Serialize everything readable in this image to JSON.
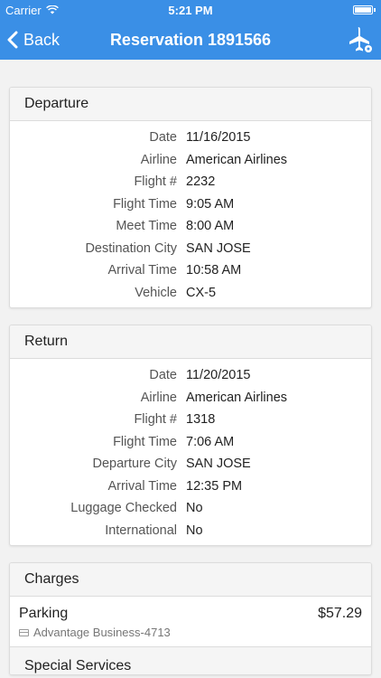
{
  "status_bar": {
    "carrier": "Carrier",
    "time": "5:21 PM"
  },
  "nav": {
    "back_label": "Back",
    "title": "Reservation 1891566"
  },
  "departure": {
    "title": "Departure",
    "rows": [
      {
        "label": "Date",
        "value": "11/16/2015"
      },
      {
        "label": "Airline",
        "value": "American Airlines"
      },
      {
        "label": "Flight #",
        "value": "2232"
      },
      {
        "label": "Flight Time",
        "value": "9:05 AM"
      },
      {
        "label": "Meet Time",
        "value": "8:00 AM"
      },
      {
        "label": "Destination City",
        "value": "SAN JOSE"
      },
      {
        "label": "Arrival Time",
        "value": "10:58 AM"
      },
      {
        "label": "Vehicle",
        "value": "CX-5"
      }
    ]
  },
  "return": {
    "title": "Return",
    "rows": [
      {
        "label": "Date",
        "value": "11/20/2015"
      },
      {
        "label": "Airline",
        "value": "American Airlines"
      },
      {
        "label": "Flight #",
        "value": "1318"
      },
      {
        "label": "Flight Time",
        "value": "7:06 AM"
      },
      {
        "label": "Departure City",
        "value": "SAN JOSE"
      },
      {
        "label": "Arrival Time",
        "value": "12:35 PM"
      },
      {
        "label": "Luggage Checked",
        "value": "No"
      },
      {
        "label": "International",
        "value": "No"
      }
    ]
  },
  "charges": {
    "title": "Charges",
    "items": [
      {
        "name": "Parking",
        "amount": "$57.29",
        "payment": "Advantage Business-4713"
      }
    ],
    "special_services_title": "Special Services"
  },
  "colors": {
    "accent": "#3a8fe6"
  }
}
